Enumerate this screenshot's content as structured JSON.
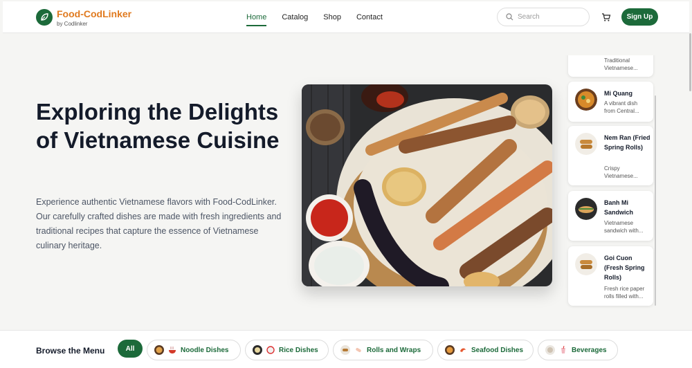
{
  "brand": {
    "name": "Food-CodLinker",
    "byline": "by Codlinker",
    "color": "#e07a1f",
    "accent": "#1c6a3a"
  },
  "nav": {
    "items": [
      {
        "label": "Home",
        "active": true
      },
      {
        "label": "Catalog"
      },
      {
        "label": "Shop"
      },
      {
        "label": "Contact"
      }
    ]
  },
  "search": {
    "placeholder": "Search",
    "icon": "search-icon"
  },
  "cart": {
    "icon": "cart-icon"
  },
  "signup": {
    "label": "Sign Up"
  },
  "hero": {
    "title": "Exploring the Delights of Vietnamese Cuisine",
    "description": "Experience authentic Vietnamese flavors with Food-CodLinker. Our carefully crafted dishes are made with fresh ingredients and traditional recipes that capture the essence of Vietnamese culinary heritage."
  },
  "dishes": [
    {
      "name": "",
      "desc_line1": "Traditional",
      "desc_line2": "Vietnamese..."
    },
    {
      "name": "Mi Quang",
      "desc_line1": "A vibrant dish",
      "desc_line2": "from Central..."
    },
    {
      "name": "Nem Ran (Fried Spring Rolls)",
      "desc_line1": "Crispy",
      "desc_line2": "Vietnamese..."
    },
    {
      "name": "Banh Mi Sandwich",
      "desc_line1": "Vietnamese",
      "desc_line2": "sandwich with..."
    },
    {
      "name": "Goi Cuon (Fresh Spring Rolls)",
      "desc_line1": "Fresh rice paper",
      "desc_line2": "rolls filled with..."
    }
  ],
  "browse": {
    "title": "Browse the Menu",
    "all_label": "All",
    "categories": [
      "Noodle Dishes",
      "Rice Dishes",
      "Rolls and Wraps",
      "Seafood Dishes",
      "Beverages"
    ]
  }
}
